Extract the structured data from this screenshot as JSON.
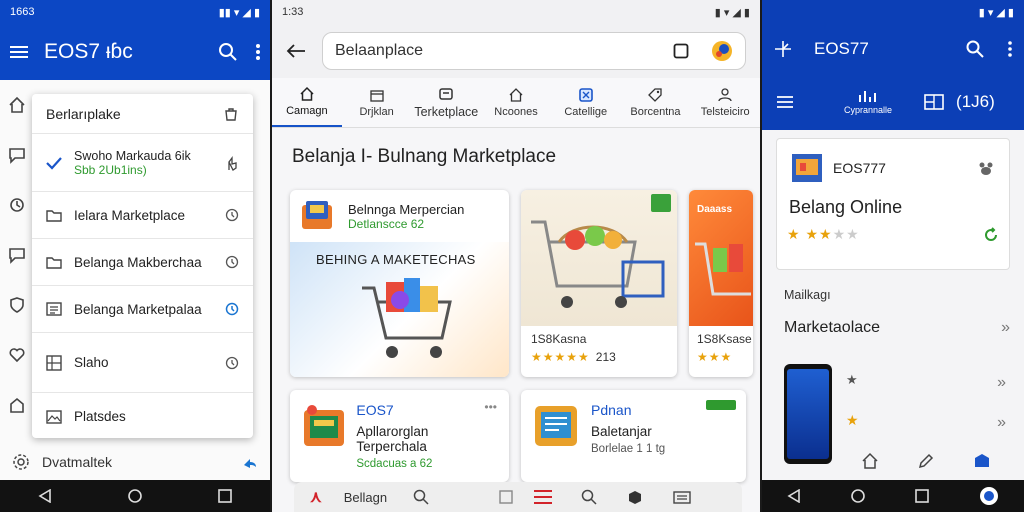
{
  "screen1": {
    "status": {
      "time": "1663"
    },
    "app_title": "EOS7 ꞁ̵ꞁ̵ꞁ̵ꞁ̵ꞁ̵ꞁ̵ꞁ̵ꞁ̵",
    "app_title_display": "EOS7 ᵼɓᴄ",
    "dropdown": {
      "header": "Berlarıplake",
      "items": [
        {
          "line1": "Swoho Markauda 6ik",
          "line2": "Sbb 2Ub1ins)"
        },
        {
          "label": "Ielara Marketplace"
        },
        {
          "label": "Belanga Makberchaa"
        },
        {
          "label": "Belanga Marketpalaa"
        },
        {
          "label": "Slaho"
        },
        {
          "label": "Platsdes"
        }
      ]
    },
    "bottom_label": "Dvatmaltek"
  },
  "screen2": {
    "status": {
      "time": "1:33"
    },
    "search_value": "Belaanplace",
    "categories": [
      "Camagn",
      "Drjklan",
      "Terketplace",
      "Ncoones",
      "Catellige",
      "Borcentna",
      "Telsteiciro"
    ],
    "headline": "Belanja I- Bulnang Marketplace",
    "card1": {
      "title": "Belnnga Merpercian",
      "subtitle": "Detlanscce 62",
      "banner": "BEHING A MAKETECHAS"
    },
    "card2": {
      "label": "1S8Kasna",
      "count": "213"
    },
    "card3": {
      "tag": "Daaass",
      "label": "1S8Ksase"
    },
    "card4": {
      "brand": "EOS7",
      "title": "Apllarorglan Terperchala",
      "subtitle": "Scdacuas a 62"
    },
    "card5": {
      "brand": "Pdnan",
      "title": "Baletanjar",
      "subtitle": "Borlelae 1 1 tg"
    },
    "mini_nav": {
      "label": "Bellagn"
    }
  },
  "screen3": {
    "app_title": "EOS77",
    "subbar_small": "Cyprannalle",
    "subbar_count": "(1J6)",
    "panel": {
      "brand": "EOS777",
      "title": "Belang Online"
    },
    "section_small": "Mailkagı",
    "section_title": "Marketaolace"
  },
  "colors": {
    "brand_blue": "#0c47c4",
    "star": "#e8a20c",
    "green": "#2f9a2f"
  }
}
